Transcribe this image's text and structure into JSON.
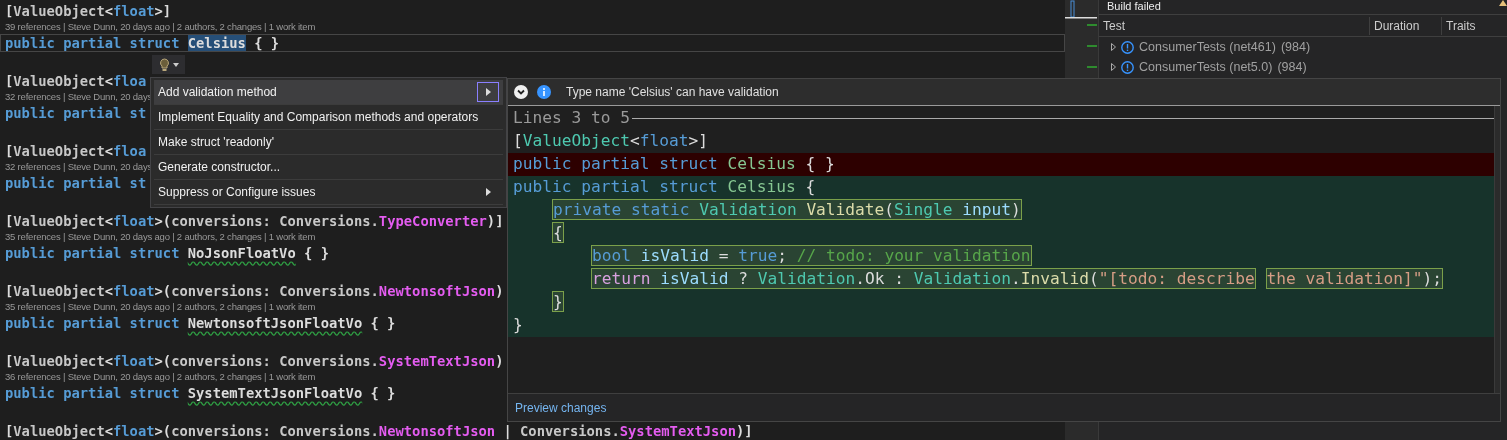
{
  "editor": {
    "blocks": [
      {
        "current": true,
        "attribute": [
          {
            "kind": "punct",
            "text": "["
          },
          {
            "kind": "ident",
            "text": "ValueObject"
          },
          {
            "kind": "punct",
            "text": "<"
          },
          {
            "kind": "keyword",
            "text": "float"
          },
          {
            "kind": "punct",
            "text": ">]"
          }
        ],
        "lens": "39 references | Steve Dunn, 20 days ago | 2 authors, 2 changes | 1 work item",
        "declaration": [
          {
            "kind": "keyword",
            "text": "public partial struct "
          },
          {
            "kind": "name-selected",
            "text": "Celsius"
          },
          {
            "kind": "punct",
            "text": " { }"
          }
        ]
      },
      {
        "current": false,
        "attribute": [
          {
            "kind": "punct",
            "text": "["
          },
          {
            "kind": "ident",
            "text": "ValueObject"
          },
          {
            "kind": "punct",
            "text": "<"
          },
          {
            "kind": "keyword",
            "text": "floa"
          }
        ],
        "lens": "32 references | Steve Dunn, 20 days",
        "declaration": [
          {
            "kind": "keyword",
            "text": "public partial st"
          }
        ]
      },
      {
        "current": false,
        "attribute": [
          {
            "kind": "punct",
            "text": "["
          },
          {
            "kind": "ident",
            "text": "ValueObject"
          },
          {
            "kind": "punct",
            "text": "<"
          },
          {
            "kind": "keyword",
            "text": "floa"
          }
        ],
        "lens": "32 references | Steve Dunn, 20 days",
        "declaration": [
          {
            "kind": "keyword",
            "text": "public partial st"
          }
        ]
      },
      {
        "current": false,
        "attribute": [
          {
            "kind": "punct",
            "text": "["
          },
          {
            "kind": "ident",
            "text": "ValueObject"
          },
          {
            "kind": "punct",
            "text": "<"
          },
          {
            "kind": "keyword",
            "text": "float"
          },
          {
            "kind": "punct",
            "text": ">("
          },
          {
            "kind": "ident",
            "text": "conversions: Conversions."
          },
          {
            "kind": "enum",
            "text": "TypeConverter"
          },
          {
            "kind": "punct",
            "text": ")]"
          }
        ],
        "lens": "35 references | Steve Dunn, 20 days ago | 2 authors, 2 changes | 1 work item",
        "declaration": [
          {
            "kind": "keyword",
            "text": "public partial struct "
          },
          {
            "kind": "name-squiggle",
            "text": "NoJsonFloatVo"
          },
          {
            "kind": "punct",
            "text": " { }"
          }
        ]
      },
      {
        "current": false,
        "attribute": [
          {
            "kind": "punct",
            "text": "["
          },
          {
            "kind": "ident",
            "text": "ValueObject"
          },
          {
            "kind": "punct",
            "text": "<"
          },
          {
            "kind": "keyword",
            "text": "float"
          },
          {
            "kind": "punct",
            "text": ">("
          },
          {
            "kind": "ident",
            "text": "conversions: Conversions."
          },
          {
            "kind": "enum",
            "text": "NewtonsoftJson"
          },
          {
            "kind": "punct",
            "text": ")"
          }
        ],
        "lens": "35 references | Steve Dunn, 20 days ago | 2 authors, 2 changes | 1 work item",
        "declaration": [
          {
            "kind": "keyword",
            "text": "public partial struct "
          },
          {
            "kind": "name-squiggle",
            "text": "NewtonsoftJsonFloatVo"
          },
          {
            "kind": "punct",
            "text": " { }"
          }
        ]
      },
      {
        "current": false,
        "attribute": [
          {
            "kind": "punct",
            "text": "["
          },
          {
            "kind": "ident",
            "text": "ValueObject"
          },
          {
            "kind": "punct",
            "text": "<"
          },
          {
            "kind": "keyword",
            "text": "float"
          },
          {
            "kind": "punct",
            "text": ">("
          },
          {
            "kind": "ident",
            "text": "conversions: Conversions."
          },
          {
            "kind": "enum",
            "text": "SystemTextJson"
          },
          {
            "kind": "punct",
            "text": ")"
          }
        ],
        "lens": "36 references | Steve Dunn, 20 days ago | 2 authors, 2 changes | 1 work item",
        "declaration": [
          {
            "kind": "keyword",
            "text": "public partial struct "
          },
          {
            "kind": "name-squiggle",
            "text": "SystemTextJsonFloatVo"
          },
          {
            "kind": "punct",
            "text": " { }"
          }
        ]
      },
      {
        "current": false,
        "attribute": [
          {
            "kind": "punct",
            "text": "["
          },
          {
            "kind": "ident",
            "text": "ValueObject"
          },
          {
            "kind": "punct",
            "text": "<"
          },
          {
            "kind": "keyword",
            "text": "float"
          },
          {
            "kind": "punct",
            "text": ">("
          },
          {
            "kind": "ident",
            "text": "conversions: Conversions."
          },
          {
            "kind": "enum",
            "text": "NewtonsoftJson"
          },
          {
            "kind": "punct",
            "text": " | "
          },
          {
            "kind": "ident",
            "text": "Conversions."
          },
          {
            "kind": "enum",
            "text": "SystemTextJson"
          },
          {
            "kind": "punct",
            "text": ")]"
          }
        ]
      }
    ]
  },
  "quick_actions": {
    "items": [
      {
        "label": "Add validation method",
        "selected": true,
        "submenu": true
      },
      {
        "label": "Implement Equality and Comparison methods and operators",
        "selected": false,
        "submenu": false
      },
      {
        "label": "Make struct 'readonly'",
        "selected": false,
        "submenu": false
      },
      {
        "label": "Generate constructor...",
        "selected": false,
        "submenu": false
      },
      {
        "label": "Suppress or Configure issues",
        "selected": false,
        "submenu": true
      }
    ]
  },
  "preview": {
    "title": "Type name 'Celsius' can have validation",
    "range": "Lines 3 to 5",
    "lines": [
      {
        "kind": "context",
        "spans": [
          {
            "boxed": false,
            "tokens": [
              {
                "kind": "punct",
                "text": "["
              },
              {
                "kind": "type",
                "text": "ValueObject"
              },
              {
                "kind": "punct",
                "text": "<"
              },
              {
                "kind": "keyword",
                "text": "float"
              },
              {
                "kind": "punct",
                "text": ">]"
              }
            ]
          }
        ]
      },
      {
        "kind": "removed",
        "spans": [
          {
            "boxed": false,
            "tokens": [
              {
                "kind": "keyword",
                "text": "public partial struct "
              },
              {
                "kind": "struct",
                "text": "Celsius"
              },
              {
                "kind": "punct",
                "text": " { }"
              }
            ]
          }
        ]
      },
      {
        "kind": "added",
        "spans": [
          {
            "boxed": false,
            "tokens": [
              {
                "kind": "keyword",
                "text": "public partial struct "
              },
              {
                "kind": "struct",
                "text": "Celsius"
              },
              {
                "kind": "punct",
                "text": " {"
              }
            ]
          }
        ]
      },
      {
        "kind": "added",
        "spans": [
          {
            "boxed": true,
            "tokens": [
              {
                "kind": "keyword",
                "text": "    private static "
              },
              {
                "kind": "type",
                "text": "Validation "
              },
              {
                "kind": "method",
                "text": "Validate"
              },
              {
                "kind": "punct",
                "text": "("
              },
              {
                "kind": "type",
                "text": "Single "
              },
              {
                "kind": "param",
                "text": "input"
              },
              {
                "kind": "punct",
                "text": ")"
              }
            ]
          }
        ]
      },
      {
        "kind": "added",
        "spans": [
          {
            "boxed": true,
            "tokens": [
              {
                "kind": "punct",
                "text": "    {"
              }
            ]
          }
        ]
      },
      {
        "kind": "added",
        "spans": [
          {
            "boxed": true,
            "tokens": [
              {
                "kind": "keyword",
                "text": "        bool "
              },
              {
                "kind": "param",
                "text": "isValid"
              },
              {
                "kind": "punct",
                "text": " = "
              },
              {
                "kind": "keyword",
                "text": "true"
              },
              {
                "kind": "punct",
                "text": "; "
              },
              {
                "kind": "comment",
                "text": "// todo: your validation"
              }
            ]
          }
        ]
      },
      {
        "kind": "added",
        "spans": [
          {
            "boxed": true,
            "tokens": [
              {
                "kind": "control",
                "text": "        return "
              },
              {
                "kind": "param",
                "text": "isValid"
              },
              {
                "kind": "punct",
                "text": " ? "
              },
              {
                "kind": "type",
                "text": "Validation"
              },
              {
                "kind": "punct",
                "text": ".Ok : "
              },
              {
                "kind": "type",
                "text": "Validation"
              },
              {
                "kind": "punct",
                "text": "."
              },
              {
                "kind": "method",
                "text": "Invalid"
              },
              {
                "kind": "punct",
                "text": "("
              },
              {
                "kind": "string",
                "text": "\"[todo: describe"
              }
            ]
          },
          {
            "boxed": true,
            "tokens": [
              {
                "kind": "string",
                "text": " the validation]\""
              },
              {
                "kind": "punct",
                "text": ");"
              }
            ]
          }
        ]
      },
      {
        "kind": "added",
        "spans": [
          {
            "boxed": true,
            "tokens": [
              {
                "kind": "punct",
                "text": "    }"
              }
            ]
          }
        ]
      },
      {
        "kind": "added",
        "spans": [
          {
            "boxed": false,
            "tokens": [
              {
                "kind": "punct",
                "text": "}"
              }
            ]
          }
        ]
      }
    ],
    "footer_link": "Preview changes"
  },
  "test_explorer": {
    "title": "Build failed",
    "columns": [
      "Test",
      "Duration",
      "Traits"
    ],
    "rows": [
      {
        "name": "ConsumerTests (net461)",
        "count": "(984)"
      },
      {
        "name": "ConsumerTests (net5.0)",
        "count": "(984)"
      }
    ]
  }
}
